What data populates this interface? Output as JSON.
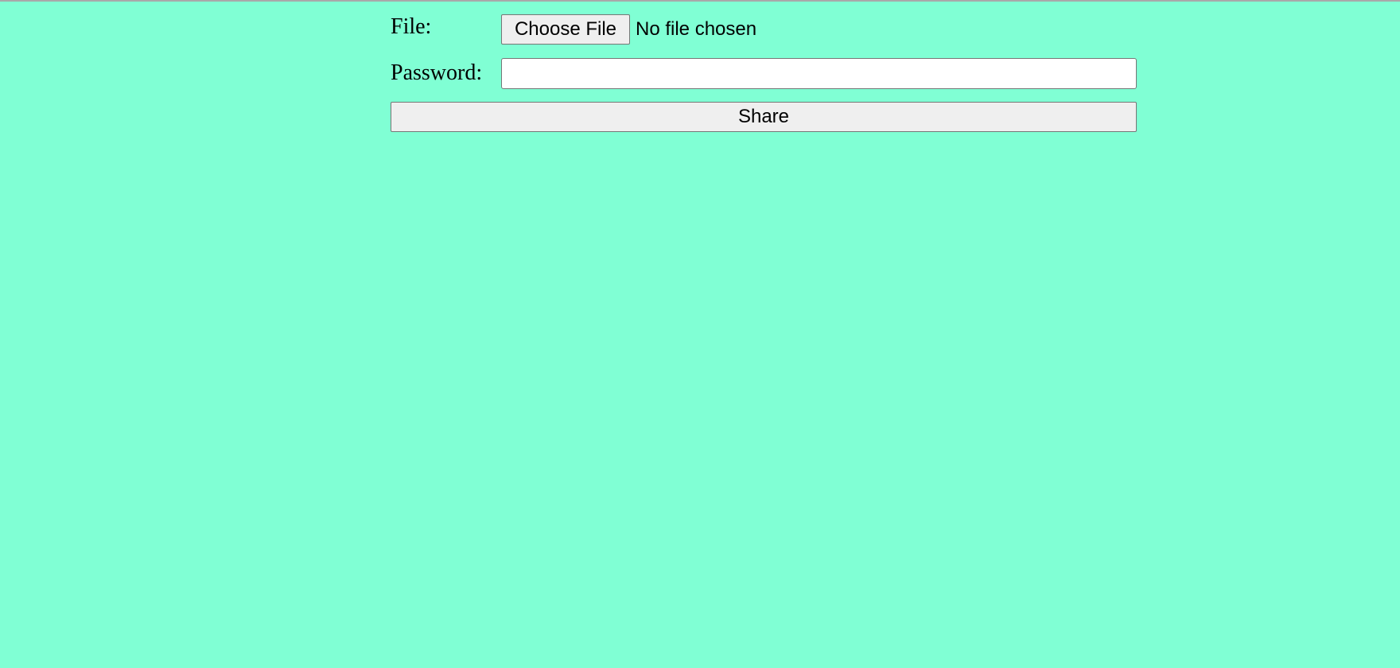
{
  "form": {
    "file_label": "File:",
    "choose_file_label": "Choose File",
    "file_status": "No file chosen",
    "password_label": "Password:",
    "password_value": "",
    "share_label": "Share"
  },
  "colors": {
    "background": "#80ffd4",
    "button_background": "#efefef",
    "input_background": "#ffffff"
  }
}
